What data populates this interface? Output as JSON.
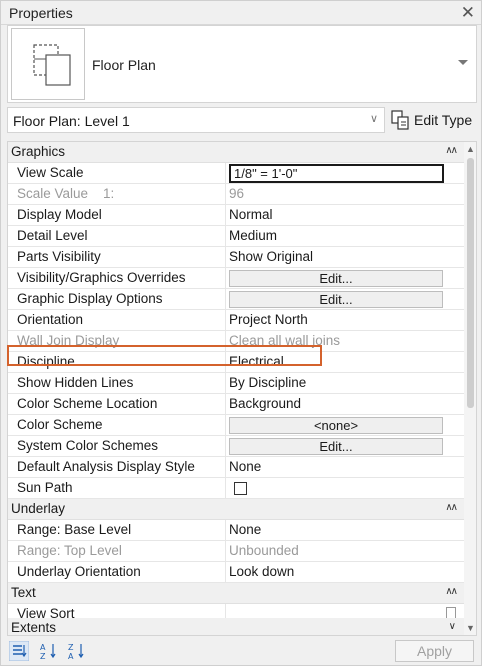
{
  "panel": {
    "title": "Properties",
    "close_glyph": "✕"
  },
  "type_selector": {
    "type_name": "Floor Plan"
  },
  "instance": {
    "selected": "Floor Plan: Level 1",
    "edit_type_label": "Edit Type"
  },
  "sections": {
    "graphics": "Graphics",
    "underlay": "Underlay",
    "text": "Text",
    "extents": "Extents"
  },
  "graphics": {
    "view_scale": {
      "name": "View Scale",
      "value": "1/8\" = 1'-0\""
    },
    "scale_value": {
      "name": "Scale Value    1:",
      "value": "96"
    },
    "display_model": {
      "name": "Display Model",
      "value": "Normal"
    },
    "detail_level": {
      "name": "Detail Level",
      "value": "Medium"
    },
    "parts_visibility": {
      "name": "Parts Visibility",
      "value": "Show Original"
    },
    "vg_overrides": {
      "name": "Visibility/Graphics Overrides",
      "value": "Edit..."
    },
    "display_options": {
      "name": "Graphic Display Options",
      "value": "Edit..."
    },
    "orientation": {
      "name": "Orientation",
      "value": "Project North"
    },
    "wall_join": {
      "name": "Wall Join Display",
      "value": "Clean all wall joins"
    },
    "discipline": {
      "name": "Discipline",
      "value": "Electrical"
    },
    "hidden_lines": {
      "name": "Show Hidden Lines",
      "value": "By Discipline"
    },
    "color_scheme_location": {
      "name": "Color Scheme Location",
      "value": "Background"
    },
    "color_scheme": {
      "name": "Color Scheme",
      "value": "<none>"
    },
    "system_color_schemes": {
      "name": "System Color Schemes",
      "value": "Edit..."
    },
    "analysis_style": {
      "name": "Default Analysis Display Style",
      "value": "None"
    },
    "sun_path": {
      "name": "Sun Path",
      "checked": false
    }
  },
  "underlay": {
    "base_level": {
      "name": "Range: Base Level",
      "value": "None"
    },
    "top_level": {
      "name": "Range: Top Level",
      "value": "Unbounded"
    },
    "orientation": {
      "name": "Underlay Orientation",
      "value": "Look down"
    }
  },
  "text": {
    "view_sort": {
      "name": "View Sort",
      "value": ""
    }
  },
  "footer": {
    "apply_label": "Apply"
  },
  "colors": {
    "highlight": "#d4622c",
    "section_bg": "#f0f0f0",
    "disabled_text": "#9a9a9a"
  }
}
